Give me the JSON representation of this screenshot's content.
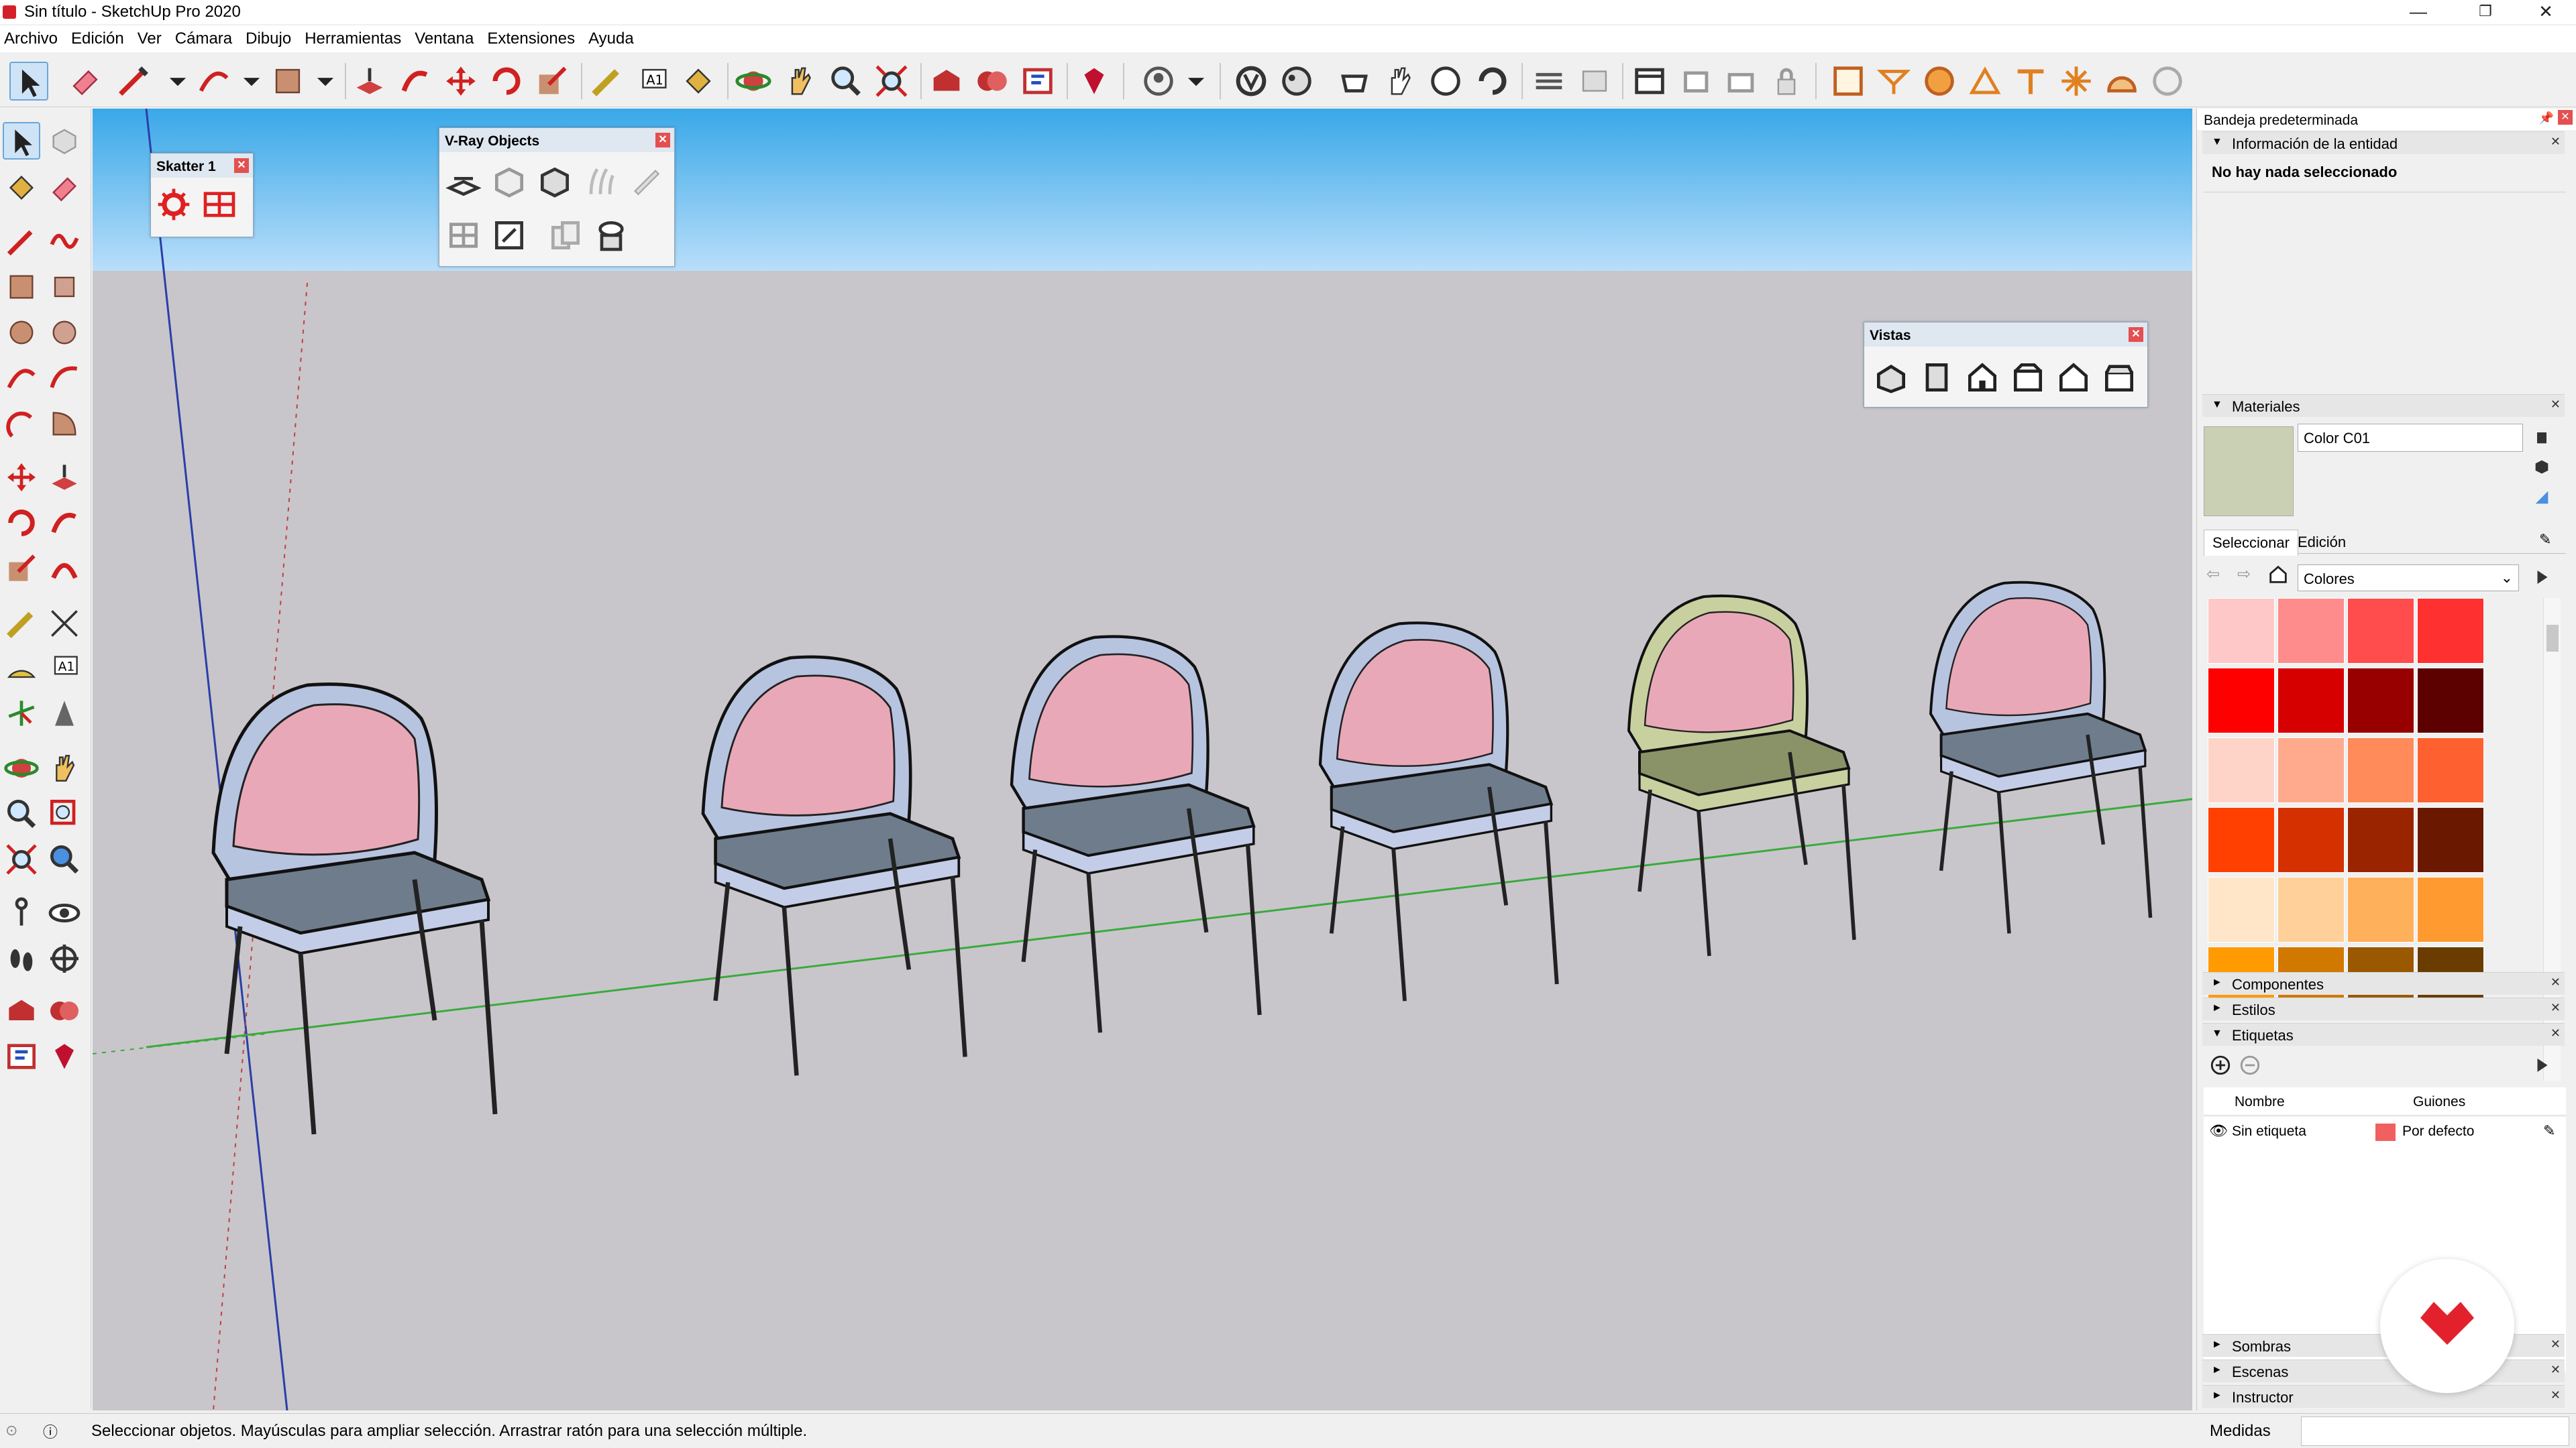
{
  "window": {
    "title": "Sin título - SketchUp Pro 2020",
    "controls": {
      "minimize": "—",
      "maximize": "❐",
      "close": "✕"
    }
  },
  "menu": [
    "Archivo",
    "Edición",
    "Ver",
    "Cámara",
    "Dibujo",
    "Herramientas",
    "Ventana",
    "Extensiones",
    "Ayuda"
  ],
  "float_windows": {
    "scatter": {
      "title": "Skatter 1"
    },
    "vray_objects": {
      "title": "V-Ray Objects"
    },
    "vistas": {
      "title": "Vistas"
    }
  },
  "right_panel": {
    "tray_title": "Bandeja predeterminada",
    "entity_info": {
      "header": "Información de la entidad",
      "message": "No hay nada seleccionado"
    },
    "materials": {
      "header": "Materiales",
      "current_material": "Color C01",
      "current_color": "#c9d0b4",
      "tabs": [
        "Seleccionar",
        "Edición"
      ],
      "library": "Colores",
      "swatches": [
        [
          "#ffc8c8",
          "#ff8c8c",
          "#ff4c4c",
          "#ff3030"
        ],
        [
          "#ff0000",
          "#d60000",
          "#980000",
          "#5c0000"
        ],
        [
          "#ffd4c8",
          "#ffaa8c",
          "#ff8a5a",
          "#ff6030"
        ],
        [
          "#ff4000",
          "#d43000",
          "#9a2400",
          "#6a1800"
        ],
        [
          "#ffe6c8",
          "#ffd09a",
          "#ffb05a",
          "#ff9a30"
        ]
      ]
    },
    "collapsed_sections": [
      "Componentes",
      "Estilos"
    ],
    "tags": {
      "header": "Etiquetas",
      "columns": [
        "Nombre",
        "Guiones"
      ],
      "rows": [
        {
          "name": "Sin etiqueta",
          "dashes": "Por defecto",
          "color": "#f06060"
        }
      ]
    },
    "bottom_sections": [
      "Sombras",
      "Escenas",
      "Instructor"
    ]
  },
  "status": {
    "message": "Seleccionar objetos. Mayúsculas para ampliar selección. Arrastrar ratón para una selección múltiple.",
    "measures_label": "Medidas",
    "measures_value": ""
  },
  "icons": [
    "select-icon",
    "eraser-icon",
    "pencil-line-icon",
    "arc-icon",
    "rectangle-icon",
    "push-pull-icon",
    "follow-me-icon",
    "move-icon",
    "rotate-icon",
    "scale-icon",
    "tape-measure-icon",
    "text-icon",
    "paint-bucket-icon",
    "orbit-icon",
    "pan-icon",
    "zoom-icon",
    "zoom-extents-icon",
    "warehouse-icon",
    "extension-warehouse-icon",
    "layout-icon",
    "ruby-icon",
    "profile-icon",
    "vray-render-icon",
    "vray-material-icon",
    "vray-light-icon",
    "vray-camera-icon",
    "section-plane-icon",
    "sandbox-icon",
    "scatter-icon",
    "vistas-iso-icon",
    "vistas-top-icon",
    "vistas-front-icon",
    "vistas-right-icon",
    "vistas-back-icon",
    "vistas-left-icon"
  ],
  "colors": {
    "sky_top": "#39a8e8",
    "ground": "#c8c6cb",
    "chair_back": "#e9a8b8",
    "chair_frame": "#b7c4e0",
    "chair_seat": "#6f7c8c",
    "accent_brand": "#e3212d"
  }
}
